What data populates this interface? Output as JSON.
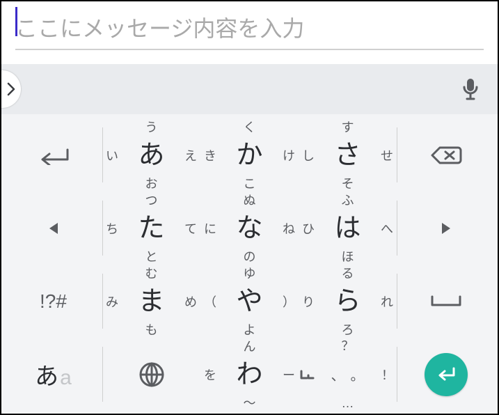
{
  "input": {
    "placeholder": "ここにメッセージ内容を入力",
    "value": ""
  },
  "fn": {
    "symbols": "!?#"
  },
  "mode": {
    "main": "あ",
    "alt": "a"
  },
  "keys": {
    "a": {
      "c": "あ",
      "t": "う",
      "b": "お",
      "l": "い",
      "r": "え"
    },
    "ka": {
      "c": "か",
      "t": "く",
      "b": "こ",
      "l": "き",
      "r": "け"
    },
    "sa": {
      "c": "さ",
      "t": "す",
      "b": "そ",
      "l": "し",
      "r": "せ"
    },
    "ta": {
      "c": "た",
      "t": "つ",
      "b": "と",
      "l": "ち",
      "r": "て"
    },
    "na": {
      "c": "な",
      "t": "ぬ",
      "b": "の",
      "l": "に",
      "r": "ね"
    },
    "ha": {
      "c": "は",
      "t": "ふ",
      "b": "ほ",
      "l": "ひ",
      "r": "へ"
    },
    "ma": {
      "c": "ま",
      "t": "む",
      "b": "も",
      "l": "み",
      "r": "め"
    },
    "ya": {
      "c": "や",
      "t": "ゆ",
      "b": "よ",
      "l": "（",
      "r": "）"
    },
    "ra": {
      "c": "ら",
      "t": "る",
      "b": "ろ",
      "l": "り",
      "r": "れ"
    },
    "wa": {
      "c": "わ",
      "t": "ん",
      "b": "〜",
      "l": "を",
      "r": "ー"
    }
  },
  "punct": {
    "t": "？",
    "b": "…",
    "l": "。",
    "r": "！",
    "cl": "、"
  }
}
